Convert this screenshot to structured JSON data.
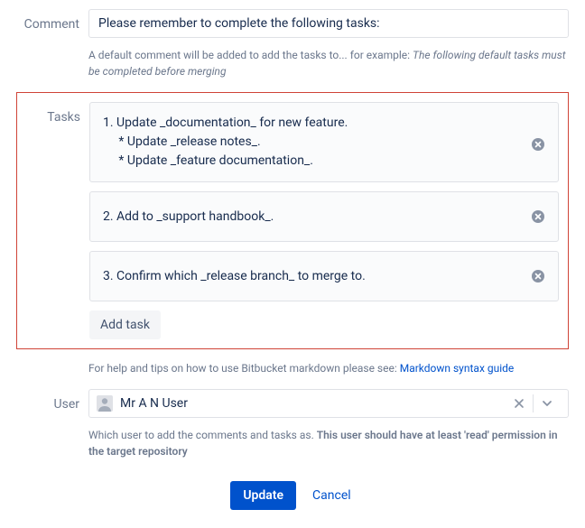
{
  "comment": {
    "label": "Comment",
    "value": "Please remember to complete the following tasks:",
    "help_prefix": "A default comment will be added to add the tasks to... for example: ",
    "help_example": "The following default tasks must be completed before merging"
  },
  "tasks": {
    "label": "Tasks",
    "items": [
      {
        "text": "1. Update _documentation_ for new feature.\n     * Update _release notes_.\n     * Update _feature documentation_."
      },
      {
        "text": "2. Add to _support handbook_."
      },
      {
        "text": "3. Confirm which _release branch_ to merge to."
      }
    ],
    "add_label": "Add task",
    "help_prefix": "For help and tips on how to use Bitbucket markdown please see: ",
    "help_link": "Markdown syntax guide"
  },
  "user": {
    "label": "User",
    "value": "Mr A N User",
    "help_prefix": "Which user to add the comments and tasks as. ",
    "help_strong": "This user should have at least 'read' permission in the target repository"
  },
  "buttons": {
    "update": "Update",
    "cancel": "Cancel"
  }
}
